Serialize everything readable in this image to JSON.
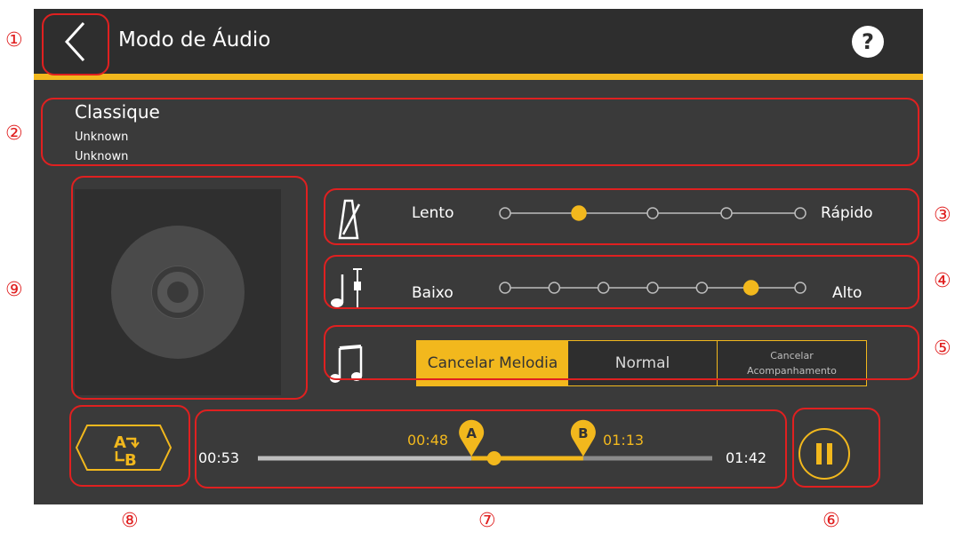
{
  "header": {
    "title": "Modo de Áudio",
    "back_icon": "chevron-left-icon",
    "help_icon": "question-circle-icon"
  },
  "song": {
    "title": "Classique",
    "artist": "Unknown",
    "album": "Unknown"
  },
  "tempo": {
    "icon": "metronome-icon",
    "min_label": "Lento",
    "max_label": "Rápido",
    "steps": 5,
    "selected_index": 1
  },
  "key": {
    "icon": "pitch-note-icon",
    "min_label": "Baixo",
    "max_label": "Alto",
    "steps": 7,
    "selected_index": 5
  },
  "mode": {
    "icon": "music-notes-icon",
    "options": [
      {
        "label": "Cancelar Melodia",
        "active": true
      },
      {
        "label": "Normal",
        "active": false
      },
      {
        "label_line1": "Cancelar",
        "label_line2": "Acompanhamento",
        "active": false
      }
    ]
  },
  "ab_repeat": {
    "icon": "ab-repeat-icon"
  },
  "progress": {
    "current_time": "00:53",
    "total_time": "01:42",
    "a_label": "A",
    "a_time": "00:48",
    "b_label": "B",
    "b_time": "01:13",
    "current_fraction": 0.52,
    "a_fraction": 0.47,
    "b_fraction": 0.716
  },
  "playback": {
    "icon": "pause-icon"
  },
  "callouts": [
    "①",
    "②",
    "③",
    "④",
    "⑤",
    "⑥",
    "⑦",
    "⑧",
    "⑨"
  ],
  "colors": {
    "accent": "#f2b81d",
    "background": "#3a3a3a",
    "header": "#2e2e2e",
    "callout": "#e02020"
  }
}
